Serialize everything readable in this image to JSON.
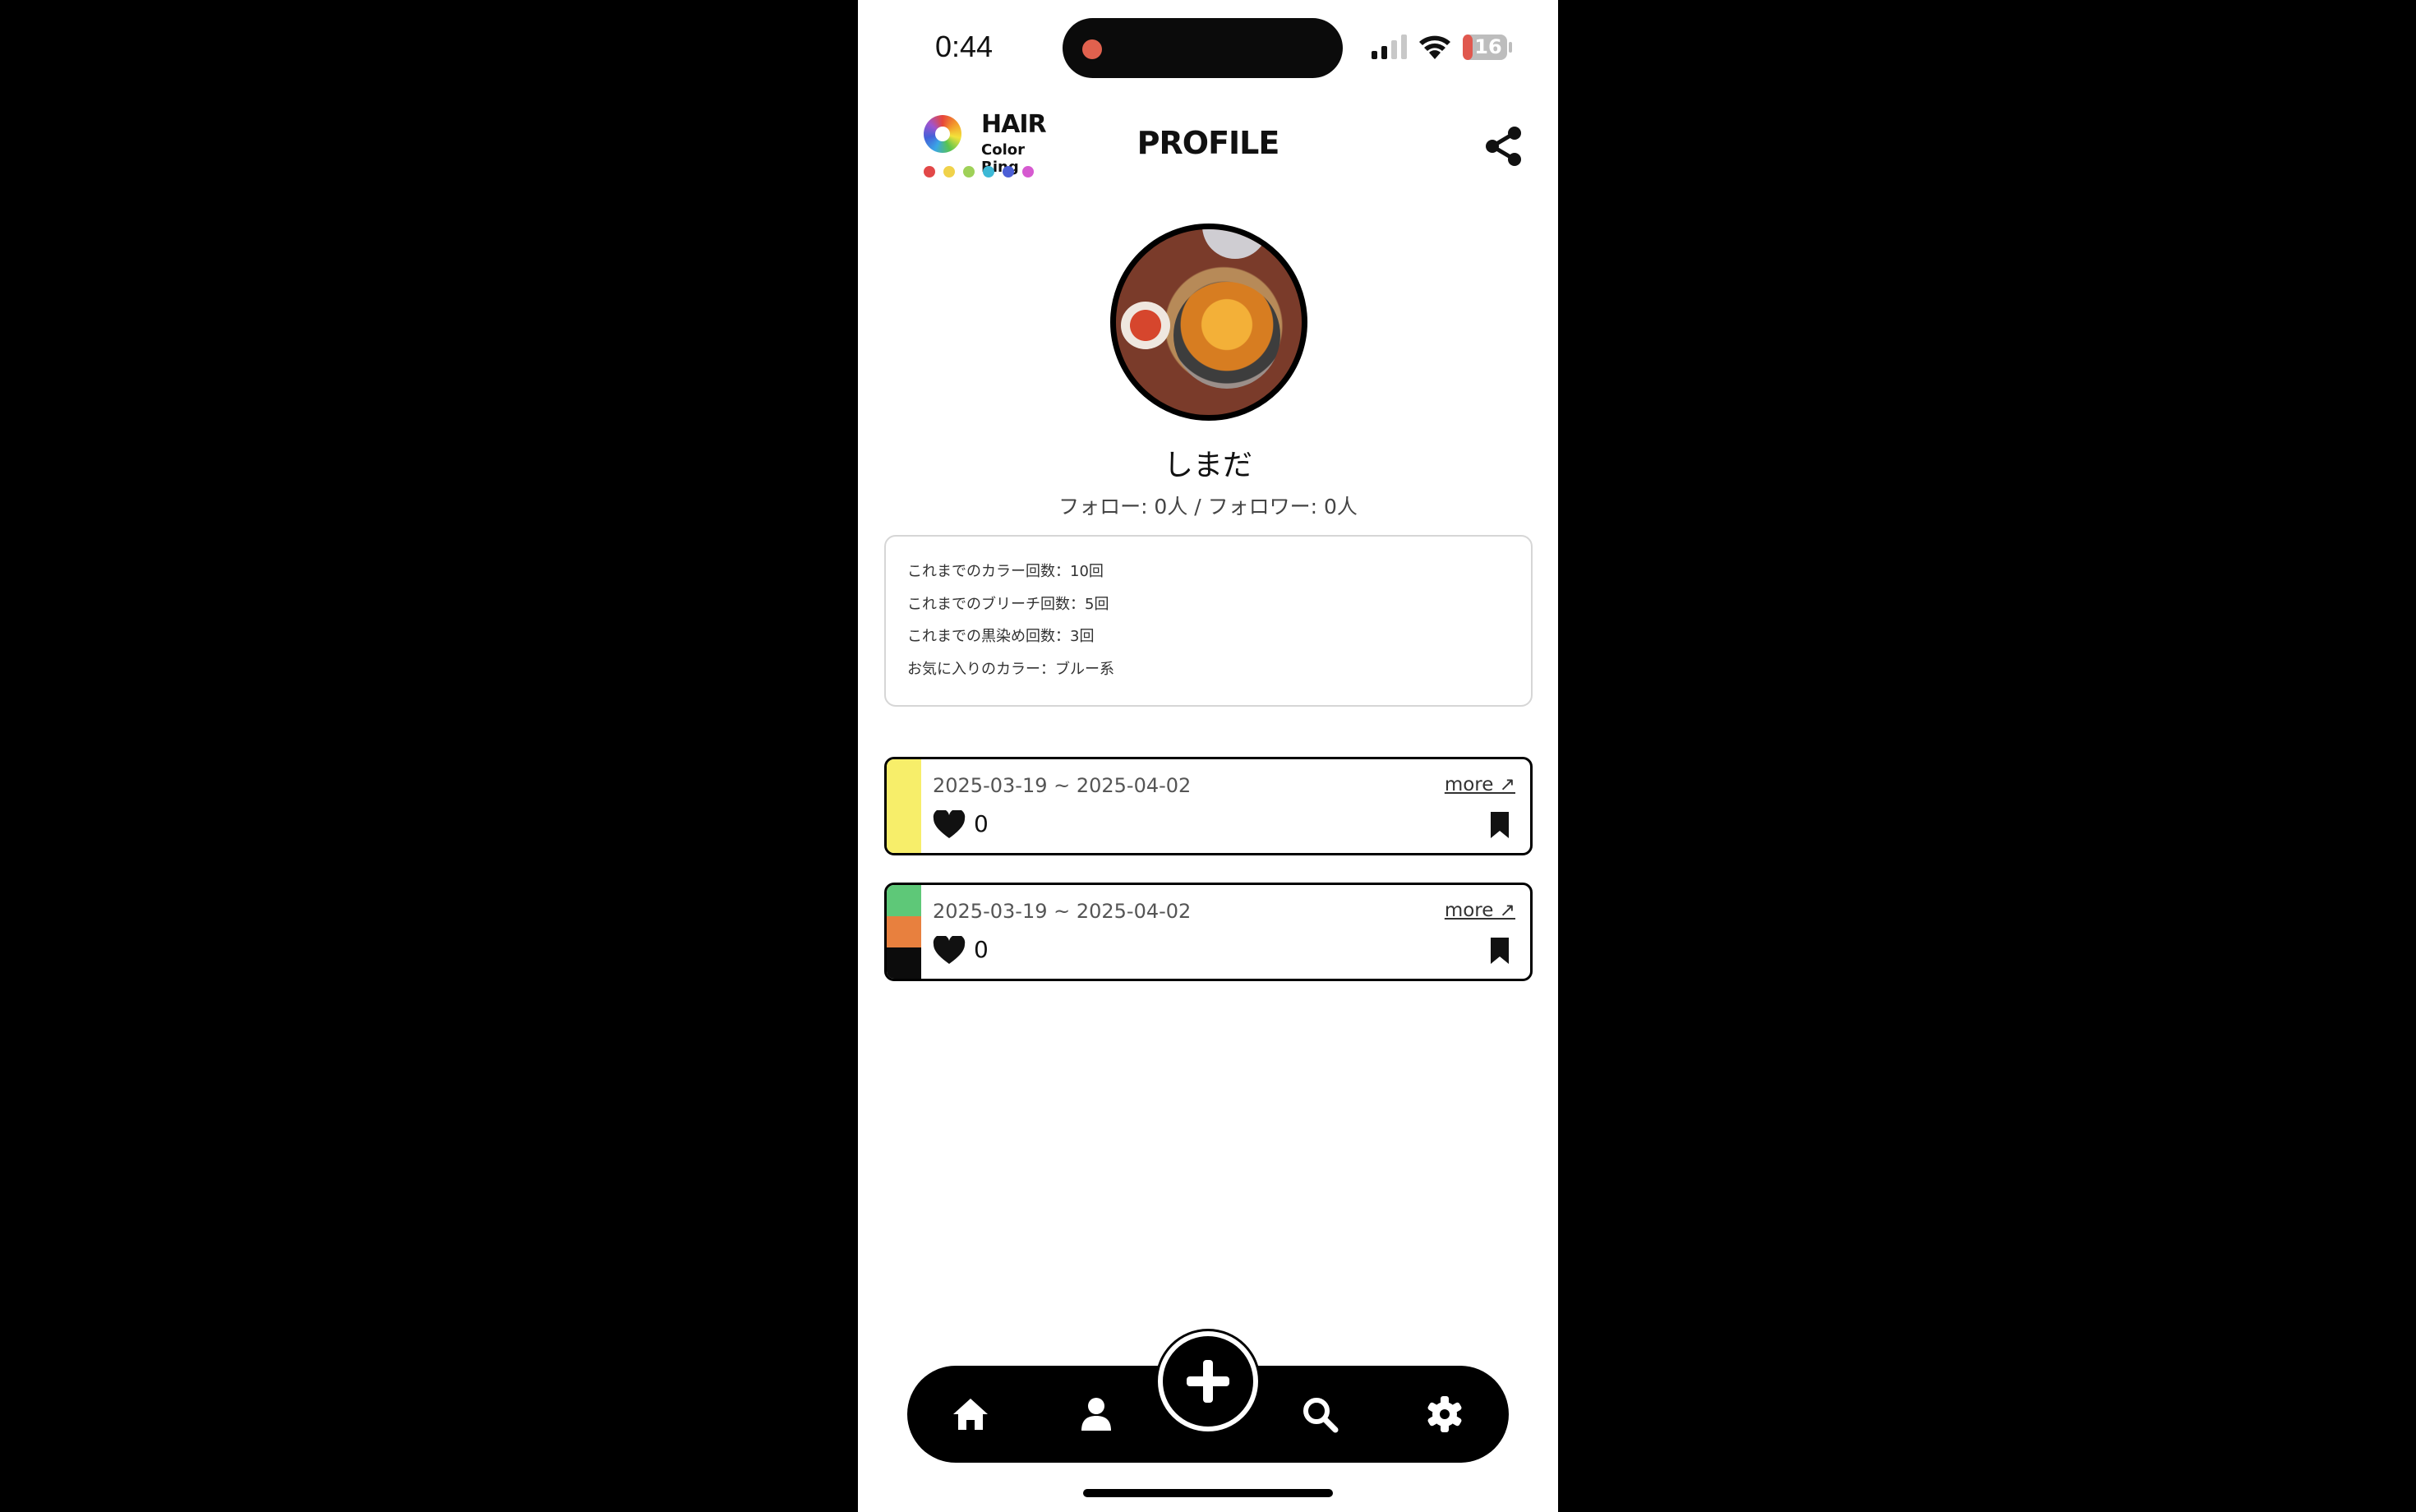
{
  "status_bar": {
    "time": "0:44",
    "battery": "16"
  },
  "header": {
    "logo_title": "HAIR",
    "logo_subtitle": "Color Ring",
    "logo_dot_colors": [
      "#e24848",
      "#f0d24a",
      "#9fd158",
      "#3db9d6",
      "#4c5fd6",
      "#d65ad0"
    ],
    "title": "PROFILE",
    "share_icon": "share-icon"
  },
  "profile": {
    "name": "しまだ",
    "follow_text": "フォロー: 0人 / フォロワー: 0人"
  },
  "stats": [
    "これまでのカラー回数：10回",
    "これまでのブリーチ回数：5回",
    "これまでの黒染め回数：3回",
    "お気に入りのカラー：ブルー系"
  ],
  "history": [
    {
      "date_range": "2025-03-19 ~ 2025-04-02",
      "more_label": "more ↗",
      "likes": "0",
      "colors": [
        "#f7ee6a"
      ]
    },
    {
      "date_range": "2025-03-19 ~ 2025-04-02",
      "more_label": "more ↗",
      "likes": "0",
      "colors": [
        "#5ec878",
        "#e8803e",
        "#0c0c0c"
      ]
    }
  ],
  "nav": {
    "items": [
      "home-icon",
      "profile-icon",
      "add-icon",
      "search-icon",
      "settings-icon"
    ]
  }
}
